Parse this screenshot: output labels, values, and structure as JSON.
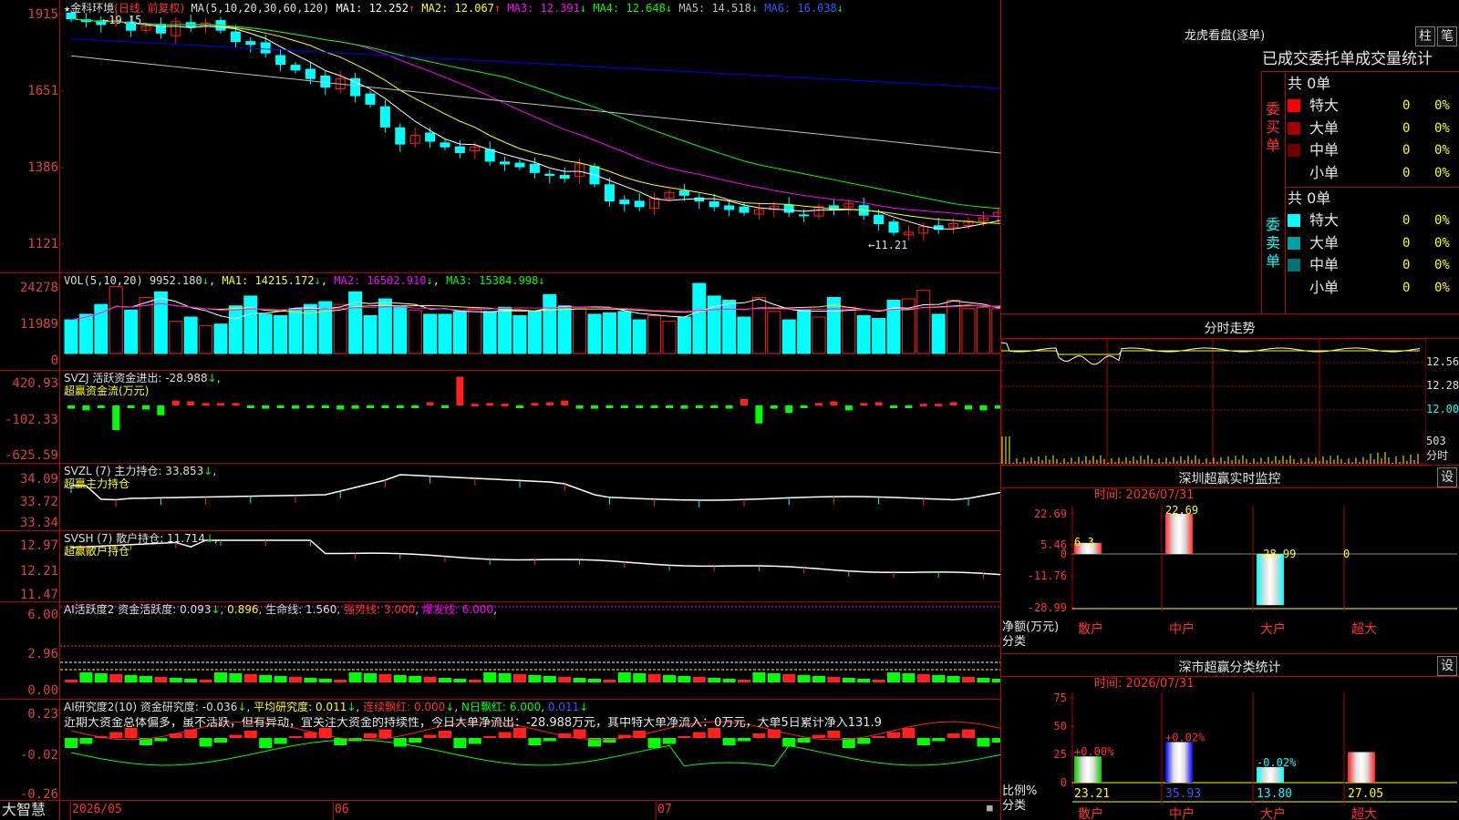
{
  "colors": {
    "up": "#ff2020",
    "down": "#00ffff",
    "grid": "#b40000",
    "ma1": "#ffffff",
    "ma2": "#ffff00",
    "ma3": "#ff00ff",
    "ma4": "#00ff00",
    "ma5": "#c0c0c0",
    "ma6": "#0000ff"
  },
  "kline": {
    "axis": [
      "1915",
      "1651",
      "1386",
      "1121"
    ],
    "stock_name": "金科环境",
    "star": "★",
    "period": "(日线, 前复权)",
    "ma_label": "MA(5,10,20,30,60,120)",
    "ma": [
      {
        "name": "MA1",
        "value": "12.252",
        "arrow": "↑"
      },
      {
        "name": "MA2",
        "value": "12.067",
        "arrow": "↑"
      },
      {
        "name": "MA3",
        "value": "12.391",
        "arrow": "↓"
      },
      {
        "name": "MA4",
        "value": "12.648",
        "arrow": "↓"
      },
      {
        "name": "MA5",
        "value": "14.518",
        "arrow": "↓"
      },
      {
        "name": "MA6",
        "value": "16.038",
        "arrow": "↓"
      }
    ],
    "high_mark": "19.15",
    "low_mark": "11.21",
    "closes": [
      19.0,
      18.9,
      18.8,
      18.95,
      18.6,
      18.75,
      18.5,
      18.9,
      18.7,
      18.85,
      18.6,
      18.2,
      18.1,
      17.8,
      17.4,
      17.2,
      16.9,
      16.6,
      16.9,
      16.3,
      16.0,
      15.2,
      14.6,
      14.9,
      14.7,
      14.5,
      14.3,
      14.5,
      14.0,
      13.9,
      13.8,
      13.6,
      13.5,
      13.4,
      13.9,
      13.2,
      12.6,
      12.5,
      12.4,
      12.7,
      12.9,
      12.8,
      12.6,
      12.4,
      12.3,
      12.2,
      12.3,
      12.4,
      12.2,
      12.1,
      12.4,
      12.3,
      12.5,
      12.1,
      11.8,
      11.5,
      11.5,
      11.7,
      11.6,
      11.8,
      11.9,
      12.0,
      12.2,
      12.25,
      12.4
    ]
  },
  "vol": {
    "axis": [
      "24278",
      "11989",
      "0"
    ],
    "label": "VOL(5,10,20)",
    "value": "9952.180",
    "items": [
      {
        "name": "MA1",
        "value": "14215.172",
        "arrow": "↓"
      },
      {
        "name": "MA2",
        "value": "16502.910",
        "arrow": "↓"
      },
      {
        "name": "MA3",
        "value": "15384.998",
        "arrow": "↓"
      }
    ],
    "values": [
      12000,
      14000,
      17500,
      23800,
      15500,
      20000,
      22000,
      11500,
      13000,
      10000,
      10500,
      17000,
      20500,
      14000,
      13500,
      16000,
      17500,
      18500,
      17500,
      22000,
      13500,
      19500,
      17000,
      15500,
      14000,
      14000,
      15000,
      16000,
      15000,
      16500,
      13500,
      15000,
      21000,
      17000,
      16000,
      14000,
      14500,
      15000,
      12000,
      13500,
      11500,
      13000,
      25000,
      20500,
      19000,
      13000,
      20000,
      15000,
      12000,
      15500,
      13000,
      20000,
      16500,
      13500,
      12500,
      19000,
      19500,
      22500,
      14000,
      19000,
      16000,
      16500,
      16000,
      17000,
      9952
    ]
  },
  "svzj": {
    "axis": [
      "420.93",
      "-102.33",
      "-625.59"
    ],
    "label": "SVZJ",
    "value_label": "活跃资金进出:",
    "value": "-28.988",
    "sub": "超赢资金流(万元)",
    "values": [
      -40,
      -60,
      -10,
      -300,
      -20,
      -50,
      -120,
      60,
      50,
      30,
      30,
      30,
      -30,
      -40,
      -30,
      -40,
      -30,
      -20,
      -50,
      -40,
      -30,
      -20,
      -30,
      -20,
      40,
      -30,
      350,
      20,
      30,
      20,
      -20,
      30,
      40,
      60,
      -40,
      -40,
      -30,
      -30,
      -20,
      -30,
      -30,
      -40,
      -30,
      -30,
      -40,
      80,
      -220,
      -40,
      -90,
      -30,
      30,
      50,
      -60,
      30,
      40,
      -30,
      -30,
      20,
      20,
      40,
      -50,
      -60,
      -40,
      90,
      60,
      -50
    ]
  },
  "svzl": {
    "axis": [
      "34.09",
      "33.72",
      "33.34"
    ],
    "label": "SVZL  (7)",
    "value_label": "主力持仓:",
    "value": "33.853",
    "sub": "超赢主力持仓"
  },
  "svsh": {
    "axis": [
      "12.97",
      "12.21",
      "11.47"
    ],
    "label": "SVSH  (7)",
    "value_label": "散户持仓:",
    "value": "11.714",
    "sub": "超赢散户持仓"
  },
  "ai_active": {
    "axis": [
      "6.00",
      "2.96",
      "0.00"
    ],
    "label": "AI活跃度2",
    "t1": "资金活跃度:",
    "v1": "0.093",
    "v2": "0.896",
    "t3": "生命线:",
    "v3": "1.560",
    "t4": "强势线:",
    "v4": "3.000",
    "t5": "爆发线:",
    "v5": "6.000"
  },
  "ai_research": {
    "axis": [
      "0.23",
      "-0.02",
      "-0.26"
    ],
    "label": "AI研究度2(10)",
    "t1": "资金研究度:",
    "v1": "-0.036",
    "t2": "平均研究度:",
    "v2": "0.011",
    "t3": "连续飘红:",
    "v3": "0.000",
    "t4": "N日飘红:",
    "v4": "6.000",
    "v5": "0.011",
    "comment": "近期大资金总体偏多，虽不活跃，但有异动，宜关注大资金的持续性，今日大单净流出：-28.988万元，其中特大单净流入：0万元，大单5日累计净入131.9"
  },
  "bottom": {
    "brand": "大智慧",
    "date1": "2026/05",
    "date2": "06",
    "date3": "07"
  },
  "dragon": {
    "title": "龙虎看盘(逐单)",
    "btn1": "柱",
    "btn2": "笔",
    "subtitle": "已成交委托单成交量统计",
    "buy": {
      "side": "委买单",
      "total": "共 0单",
      "rows": [
        {
          "name": "特大",
          "count": "0",
          "pct": "0%",
          "color": "#ff0000"
        },
        {
          "name": "大单",
          "count": "0",
          "pct": "0%",
          "color": "#a00000"
        },
        {
          "name": "中单",
          "count": "0",
          "pct": "0%",
          "color": "#6a0000"
        },
        {
          "name": "小单",
          "count": "0",
          "pct": "0%",
          "color": "#000000"
        }
      ]
    },
    "sell": {
      "side": "委卖单",
      "total": "共 0单",
      "rows": [
        {
          "name": "特大",
          "count": "0",
          "pct": "0%",
          "color": "#00ffff"
        },
        {
          "name": "大单",
          "count": "0",
          "pct": "0%",
          "color": "#00a0a0"
        },
        {
          "name": "中单",
          "count": "0",
          "pct": "0%",
          "color": "#007070"
        },
        {
          "name": "小单",
          "count": "0",
          "pct": "0%",
          "color": "#000000"
        }
      ]
    }
  },
  "intraday": {
    "title": "分时走势",
    "axis": [
      "12.56",
      "12.28",
      "12.00"
    ],
    "vol_label1": "503",
    "vol_label2": "分时"
  },
  "sz_monitor": {
    "title": "深圳超赢实时监控",
    "btn": "设",
    "time_label": "时间:",
    "time": "2026/07/31",
    "axis": [
      "22.69",
      "5.46",
      "0",
      "-11.76",
      "-28.99"
    ],
    "bar_labels": [
      "6.3",
      "22.69",
      "-28.99",
      "0"
    ],
    "values": [
      6.3,
      22.69,
      -28.99,
      0
    ],
    "ylabel1": "净额(万元)",
    "ylabel2": "分类",
    "categories": [
      "散户",
      "中户",
      "大户",
      "超大"
    ]
  },
  "sh_stats": {
    "title": "深市超赢分类统计",
    "btn": "设",
    "time_label": "时间:",
    "time": "2026/07/31",
    "axis": [
      "75",
      "50",
      "25",
      "0"
    ],
    "bar_labels": [
      "+0.00%",
      "+0.02%",
      "-0.02%",
      ""
    ],
    "values": [
      23.21,
      35.93,
      13.8,
      27.05
    ],
    "value_labels": [
      "23.21",
      "35.93",
      "13.80",
      "27.05"
    ],
    "ylabel1": "比例%",
    "ylabel2": "分类",
    "categories": [
      "散户",
      "中户",
      "大户",
      "超大"
    ]
  }
}
